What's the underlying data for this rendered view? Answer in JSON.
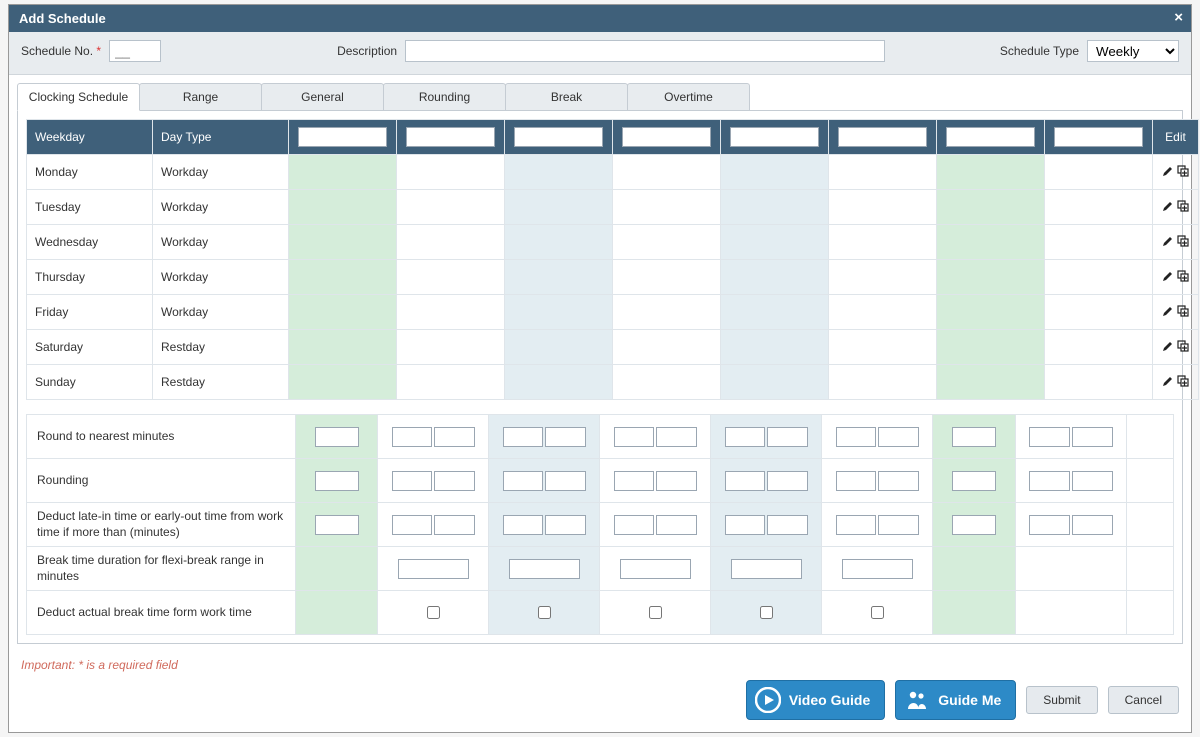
{
  "title": "Add Schedule",
  "header": {
    "schedule_no_label": "Schedule No.",
    "schedule_no_placeholder": "__",
    "description_label": "Description",
    "schedule_type_label": "Schedule Type",
    "schedule_type_value": "Weekly"
  },
  "tabs": [
    "Clocking Schedule",
    "Range",
    "General",
    "Rounding",
    "Break",
    "Overtime"
  ],
  "active_tab_index": 0,
  "schedule_columns": {
    "weekday": "Weekday",
    "daytype": "Day Type",
    "edit": "Edit"
  },
  "rows": [
    {
      "weekday": "Monday",
      "daytype": "Workday"
    },
    {
      "weekday": "Tuesday",
      "daytype": "Workday"
    },
    {
      "weekday": "Wednesday",
      "daytype": "Workday"
    },
    {
      "weekday": "Thursday",
      "daytype": "Workday"
    },
    {
      "weekday": "Friday",
      "daytype": "Workday"
    },
    {
      "weekday": "Saturday",
      "daytype": "Restday"
    },
    {
      "weekday": "Sunday",
      "daytype": "Restday"
    }
  ],
  "options": [
    {
      "label": "Round to nearest minutes",
      "type": "pair_with_single_first"
    },
    {
      "label": "Rounding",
      "type": "pair_with_single_first"
    },
    {
      "label": "Deduct late-in time or early-out time from work time if more than (minutes)",
      "type": "pair_with_single_first"
    },
    {
      "label": "Break time duration for flexi-break range in minutes",
      "type": "single_skip_first"
    },
    {
      "label": "Deduct actual break time form work time",
      "type": "checkbox_skip_first"
    }
  ],
  "footer": {
    "footnote": "Important: * is a required field",
    "video_guide": "Video Guide",
    "guide_me": "Guide Me",
    "submit": "Submit",
    "cancel": "Cancel"
  },
  "clock_col_colors": [
    "green",
    "white",
    "blue",
    "white",
    "blue",
    "white",
    "green",
    "white"
  ]
}
